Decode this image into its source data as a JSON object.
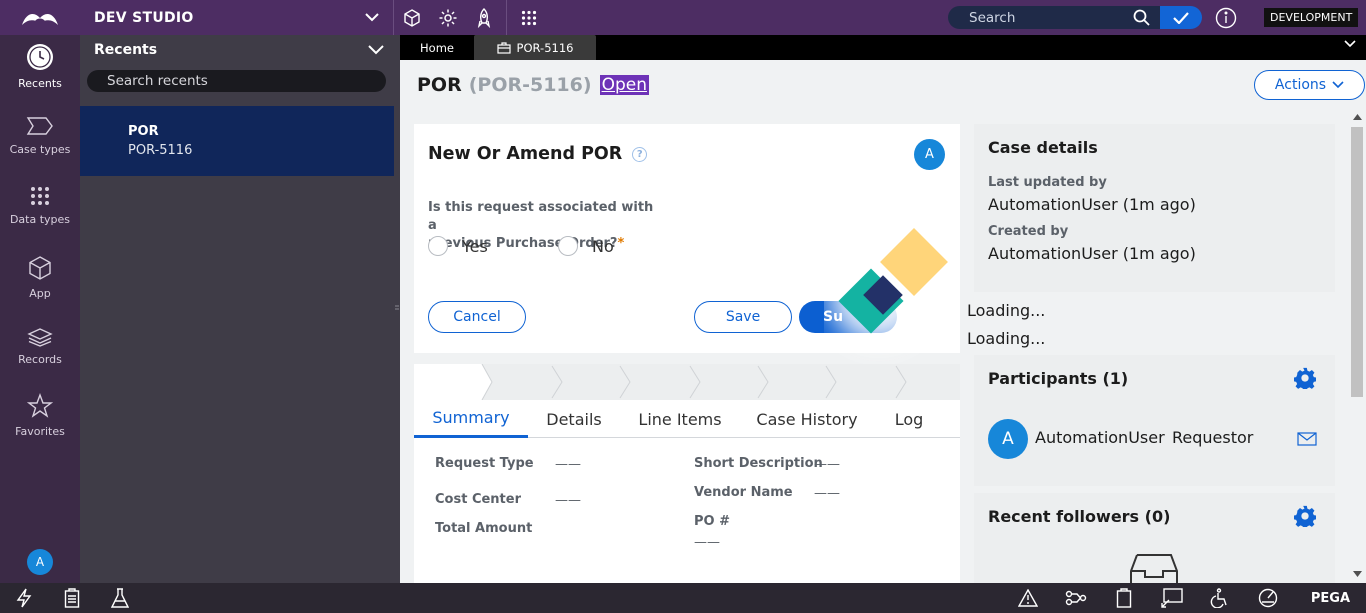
{
  "topbar": {
    "studio_label": "DEV STUDIO",
    "search_placeholder": "Search",
    "environment": "DEVELOPMENT"
  },
  "leftnav": {
    "items": [
      {
        "label": "Recents",
        "icon": "recents-clock-icon"
      },
      {
        "label": "Case types",
        "icon": "case-types-icon"
      },
      {
        "label": "Data types",
        "icon": "data-types-grid-icon"
      },
      {
        "label": "App",
        "icon": "app-cube-icon"
      },
      {
        "label": "Records",
        "icon": "records-layers-icon"
      },
      {
        "label": "Favorites",
        "icon": "favorites-star-icon"
      }
    ],
    "avatar": "A"
  },
  "recents": {
    "title": "Recents",
    "search_placeholder": "Search recents",
    "items": [
      {
        "title": "POR",
        "subtitle": "POR-5116"
      }
    ]
  },
  "tabs": [
    {
      "label": "Home"
    },
    {
      "label": "POR-5116"
    }
  ],
  "case": {
    "title": "POR",
    "id": "(POR-5116)",
    "status": "Open",
    "actions_label": "Actions"
  },
  "form": {
    "title": "New Or Amend POR",
    "help": "?",
    "avatar": "A",
    "question_line1": "Is this request associated with a",
    "question_line2": "previous Purchase Order?",
    "required_mark": "*",
    "options": [
      "Yes",
      "No"
    ],
    "cancel_label": "Cancel",
    "save_label": "Save",
    "submit_label": "Su"
  },
  "summary": {
    "tabs": [
      "Summary",
      "Details",
      "Line Items",
      "Case History",
      "Log"
    ],
    "fields": {
      "request_type": "Request Type",
      "cost_center": "Cost Center",
      "total_amount": "Total Amount",
      "short_description": "Short Description",
      "vendor_name": "Vendor Name",
      "po_number": "PO #",
      "empty_value": "——"
    }
  },
  "case_details": {
    "title": "Case details",
    "last_updated_label": "Last updated by",
    "last_updated_value": "AutomationUser (1m ago)",
    "created_label": "Created by",
    "created_value": "AutomationUser (1m ago)"
  },
  "loading": [
    "Loading...",
    "Loading..."
  ],
  "participants": {
    "title": "Participants (1)",
    "avatar": "A",
    "name": "AutomationUser",
    "role": "Requestor"
  },
  "followers": {
    "title": "Recent followers (0)"
  },
  "bottombar": {
    "brand": "PEGA"
  },
  "colors": {
    "topbar": "#4d2d63",
    "accent": "#1063d3",
    "status": "#6e33b7",
    "nav_bg": "#3b2a46"
  }
}
